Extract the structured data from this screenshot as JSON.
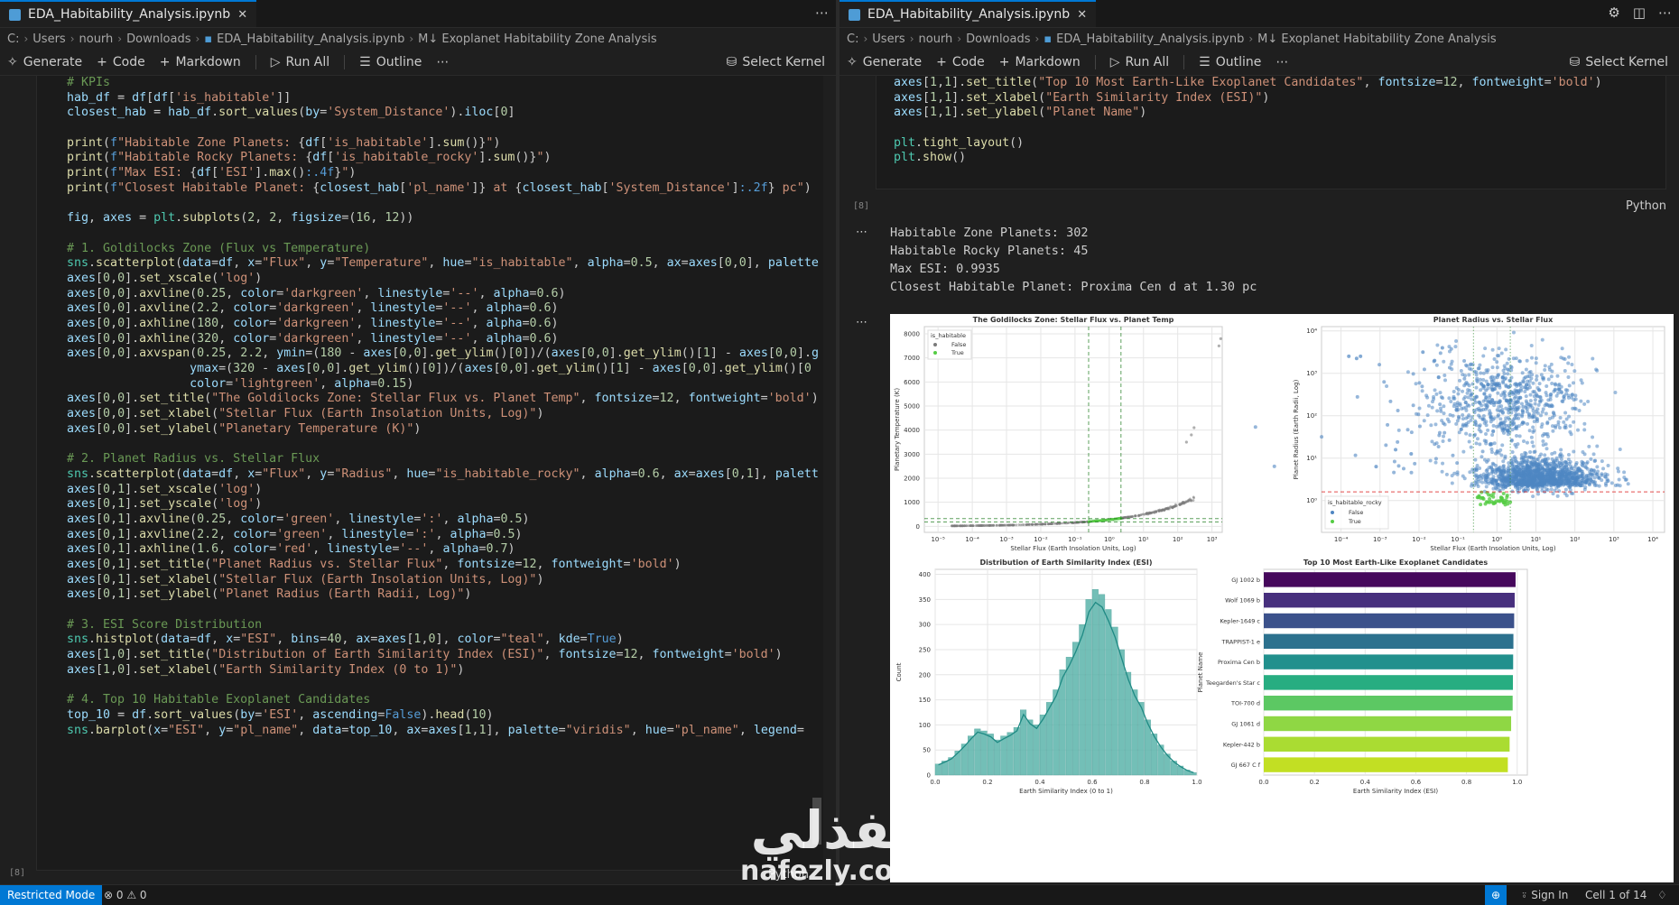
{
  "left": {
    "tab_title": "EDA_Habitability_Analysis.ipynb",
    "breadcrumb": [
      "C:",
      "Users",
      "nourh",
      "Downloads",
      "EDA_Habitability_Analysis.ipynb",
      "M↓ Exoplanet Habitability Zone Analysis"
    ],
    "toolbar": {
      "generate": "Generate",
      "code": "Code",
      "markdown": "Markdown",
      "run_all": "Run All",
      "outline": "Outline",
      "kernel": "Select Kernel"
    },
    "exec_count": "[8]",
    "lang": "Python"
  },
  "right": {
    "tab_title": "EDA_Habitability_Analysis.ipynb",
    "breadcrumb": [
      "C:",
      "Users",
      "nourh",
      "Downloads",
      "EDA_Habitability_Analysis.ipynb",
      "M↓ Exoplanet Habitability Zone Analysis"
    ],
    "toolbar": {
      "generate": "Generate",
      "code": "Code",
      "markdown": "Markdown",
      "run_all": "Run All",
      "outline": "Outline",
      "kernel": "Select Kernel"
    },
    "exec_count": "[8]",
    "lang": "Python",
    "output_lines": [
      "Habitable Zone Planets: 302",
      "Habitable Rocky Planets: 45",
      "Max ESI: 0.9935",
      "Closest Habitable Planet: Proxima Cen d at 1.30 pc"
    ]
  },
  "status": {
    "mode": "Restricted Mode",
    "problems": "⊗ 0 ⚠ 0",
    "sign_in": "Sign In",
    "cell": "Cell 1 of 14"
  },
  "watermark": {
    "arabic": "نفذلي",
    "latin": "nafezly.com"
  },
  "colors": {
    "accent": "#0078d4",
    "habitable": "#55cc44",
    "non_habitable": "#7a7a7a",
    "rocky_false": "#4f86c2",
    "hist": "#5bb4ab",
    "kde": "#1f8a84"
  },
  "chart_data": [
    {
      "type": "scatter",
      "title": "The Goldilocks Zone: Stellar Flux vs. Planet Temp",
      "xlabel": "Stellar Flux (Earth Insolation Units, Log)",
      "ylabel": "Planetary Temperature (K)",
      "x_scale": "log",
      "x_tick_labels": [
        "10⁻⁵",
        "10⁻⁴",
        "10⁻³",
        "10⁻²",
        "10⁻¹",
        "10⁰",
        "10¹",
        "10²",
        "10³"
      ],
      "y_ticks": [
        0,
        1000,
        2000,
        3000,
        4000,
        5000,
        6000,
        7000,
        8000
      ],
      "legend_title": "is_habitable",
      "legend": [
        "False",
        "True"
      ],
      "legend_position": "top-left",
      "vlines": [
        0.25,
        2.2
      ],
      "hlines": [
        180,
        320
      ],
      "outliers": [
        [
          180,
          3500
        ],
        [
          250,
          3800
        ],
        [
          300,
          4100
        ],
        [
          1600,
          7500
        ],
        [
          1800,
          7800
        ]
      ]
    },
    {
      "type": "scatter",
      "title": "Planet Radius vs. Stellar Flux",
      "xlabel": "Stellar Flux (Earth Insolation Units, Log)",
      "ylabel": "Planet Radius (Earth Radii, Log)",
      "x_scale": "log",
      "y_scale": "log",
      "x_tick_labels": [
        "10⁻⁴",
        "10⁻³",
        "10⁻²",
        "10⁻¹",
        "10⁰",
        "10¹",
        "10²",
        "10³",
        "10⁴"
      ],
      "y_tick_labels": [
        "10⁰",
        "10¹",
        "10²",
        "10³",
        "10⁴"
      ],
      "legend_title": "is_habitable_rocky",
      "legend": [
        "False",
        "True"
      ],
      "legend_position": "bottom-left",
      "vlines": [
        0.25,
        2.2
      ],
      "hline": 1.6
    },
    {
      "type": "bar",
      "title": "Distribution of Earth Similarity Index (ESI)",
      "xlabel": "Earth Similarity Index (0 to 1)",
      "ylabel": "Count",
      "x_ticks": [
        0.0,
        0.2,
        0.4,
        0.6,
        0.8,
        1.0
      ],
      "y_ticks": [
        0,
        50,
        100,
        150,
        200,
        250,
        300,
        350,
        400
      ],
      "bins": 40,
      "values": [
        22,
        28,
        35,
        48,
        62,
        78,
        92,
        88,
        82,
        70,
        78,
        85,
        95,
        130,
        110,
        100,
        120,
        145,
        170,
        210,
        235,
        265,
        300,
        350,
        370,
        360,
        330,
        295,
        250,
        205,
        170,
        145,
        110,
        82,
        60,
        42,
        28,
        18,
        10,
        5
      ]
    },
    {
      "type": "bar",
      "title": "Top 10 Most Earth-Like Exoplanet Candidates",
      "xlabel": "Earth Similarity Index (ESI)",
      "ylabel": "Planet Name",
      "x_ticks": [
        0.0,
        0.2,
        0.4,
        0.6,
        0.8,
        1.0
      ],
      "categories": [
        "GJ 1002 b",
        "Wolf 1069 b",
        "Kepler-1649 c",
        "TRAPPIST-1 e",
        "Proxima Cen b",
        "Teegarden's Star c",
        "TOI-700 d",
        "GJ 1061 d",
        "Kepler-442 b",
        "GJ 667 C f"
      ],
      "values": [
        0.9935,
        0.99,
        0.988,
        0.985,
        0.984,
        0.983,
        0.982,
        0.976,
        0.97,
        0.963
      ]
    }
  ]
}
